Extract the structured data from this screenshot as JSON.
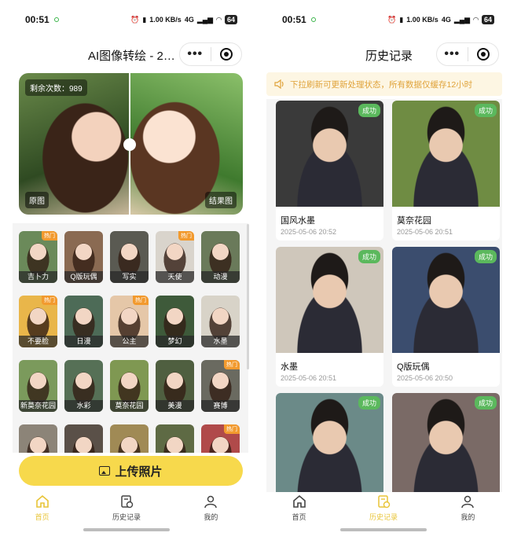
{
  "left": {
    "status": {
      "time": "00:51",
      "speed": "1.00 KB/s",
      "network": "4G",
      "battery": "64"
    },
    "nav": {
      "title": "AI图像转绘 - 2…"
    },
    "compare": {
      "remaining": "剩余次数：989",
      "before_label": "原图",
      "after_label": "结果图",
      "split": 0.5
    },
    "styles": [
      {
        "label": "吉卜力",
        "hot": "热门",
        "color": "#6b8a5a"
      },
      {
        "label": "Q版玩偶",
        "hot": "",
        "color": "#8a6a52"
      },
      {
        "label": "写实",
        "hot": "",
        "color": "#5a5a52"
      },
      {
        "label": "天使",
        "hot": "热门",
        "color": "#d9d4cc"
      },
      {
        "label": "动漫",
        "hot": "",
        "color": "#6a7a5a"
      },
      {
        "label": "不要脸",
        "hot": "热门",
        "color": "#e9b64a"
      },
      {
        "label": "日漫",
        "hot": "",
        "color": "#4d6b57"
      },
      {
        "label": "公主",
        "hot": "热门",
        "color": "#e5c7a8"
      },
      {
        "label": "梦幻",
        "hot": "",
        "color": "#3e5a3a"
      },
      {
        "label": "水墨",
        "hot": "",
        "color": "#d8d3c8"
      },
      {
        "label": "新莫奈花园",
        "hot": "",
        "color": "#7b9a5c"
      },
      {
        "label": "水彩",
        "hot": "",
        "color": "#567056"
      },
      {
        "label": "莫奈花园",
        "hot": "",
        "color": "#7f9852"
      },
      {
        "label": "美漫",
        "hot": "",
        "color": "#4f5f40"
      },
      {
        "label": "赛博",
        "hot": "热门",
        "color": "#6a6a60"
      },
      {
        "label": "",
        "hot": "",
        "color": "#8c8478"
      },
      {
        "label": "",
        "hot": "",
        "color": "#5a5048"
      },
      {
        "label": "",
        "hot": "",
        "color": "#a08a55"
      },
      {
        "label": "",
        "hot": "",
        "color": "#5e6a44"
      },
      {
        "label": "",
        "hot": "热门",
        "color": "#b04a4a"
      }
    ],
    "upload": {
      "label": "上传照片"
    }
  },
  "right": {
    "status": {
      "time": "00:51",
      "speed": "1.00 KB/s",
      "network": "4G",
      "battery": "64"
    },
    "nav": {
      "title": "历史记录"
    },
    "notice": "下拉刷新可更新处理状态，所有数据仅缓存12小时",
    "records": [
      {
        "name": "国风水墨",
        "time": "2025-05-06 20:52",
        "status": "成功",
        "color": "#3a3a3a"
      },
      {
        "name": "莫奈花园",
        "time": "2025-05-06 20:51",
        "status": "成功",
        "color": "#6f8c43"
      },
      {
        "name": "水墨",
        "time": "2025-05-06 20:51",
        "status": "成功",
        "color": "#cfc7bb"
      },
      {
        "name": "Q版玩偶",
        "time": "2025-05-06 20:50",
        "status": "成功",
        "color": "#3b4d6e"
      },
      {
        "name": "",
        "time": "",
        "status": "成功",
        "color": "#6b8a88"
      },
      {
        "name": "",
        "time": "",
        "status": "成功",
        "color": "#7a6a66"
      }
    ]
  },
  "tabs": {
    "home": "首页",
    "history": "历史记录",
    "mine": "我的"
  },
  "colors": {
    "accent": "#f7d94c",
    "active_tab": "#e8c437",
    "success": "#5bb85d",
    "hot": "#f29a2e",
    "notice_text": "#e0a33a"
  }
}
